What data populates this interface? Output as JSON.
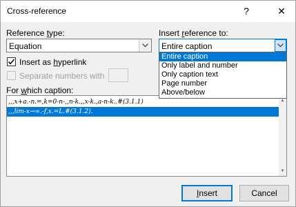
{
  "window": {
    "title": "Cross-reference",
    "help_glyph": "?",
    "close_glyph": "✕"
  },
  "reference_type": {
    "label_pre": "Reference ",
    "label_ul": "t",
    "label_post": "ype:",
    "value": "Equation"
  },
  "insert_reference_to": {
    "label_pre": "Insert ",
    "label_ul": "r",
    "label_post": "eference to:",
    "value": "Entire caption",
    "options": [
      "Entire caption",
      "Only label and number",
      "Only caption text",
      "Page number",
      "Above/below"
    ],
    "selected_index": 0
  },
  "insert_as_hyperlink": {
    "label_pre": "Insert as ",
    "label_ul": "h",
    "label_post": "yperlink",
    "checked": true
  },
  "separate_numbers": {
    "label": "Separate numbers with",
    "checked": false,
    "enabled": false
  },
  "caption_list": {
    "label_pre": "For ",
    "label_ul": "w",
    "label_post": "hich caption:",
    "items": [
      ",,,x+a.-n.=,k=0-n-,,n-k.,,x-k.,a-n-k..#(3.1.1)",
      ",,,lim-x→∞.-f,x.=L.#(3.1.2)."
    ],
    "selected_index": 1
  },
  "buttons": {
    "insert_ul": "I",
    "insert_post": "nsert",
    "cancel": "Cancel"
  },
  "colors": {
    "accent": "#0078d7",
    "dialog_bg": "#f0f0f0"
  }
}
